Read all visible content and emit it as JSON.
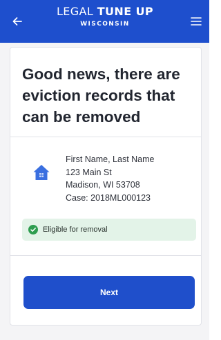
{
  "header": {
    "brand_light": "LEGAL",
    "brand_bold": "TUNE UP",
    "brand_sub": "WISCONSIN",
    "back_icon": "arrow-left-icon",
    "menu_icon": "hamburger-menu-icon"
  },
  "main": {
    "headline": "Good news, there are eviction records that can be removed",
    "record": {
      "icon": "house-icon",
      "name": "First Name, Last Name",
      "street": "123 Main St",
      "city": "Madison, WI  53708",
      "case": "Case: 2018ML000123"
    },
    "status": {
      "icon": "check-circle-icon",
      "label": "Eligible for removal"
    },
    "next_label": "Next"
  },
  "colors": {
    "header_bg": "#1e4fcd",
    "button_bg": "#1f4fcb",
    "status_bg": "#e3f3e8",
    "status_icon": "#2e9d4f",
    "house_icon": "#3a6fe0"
  }
}
